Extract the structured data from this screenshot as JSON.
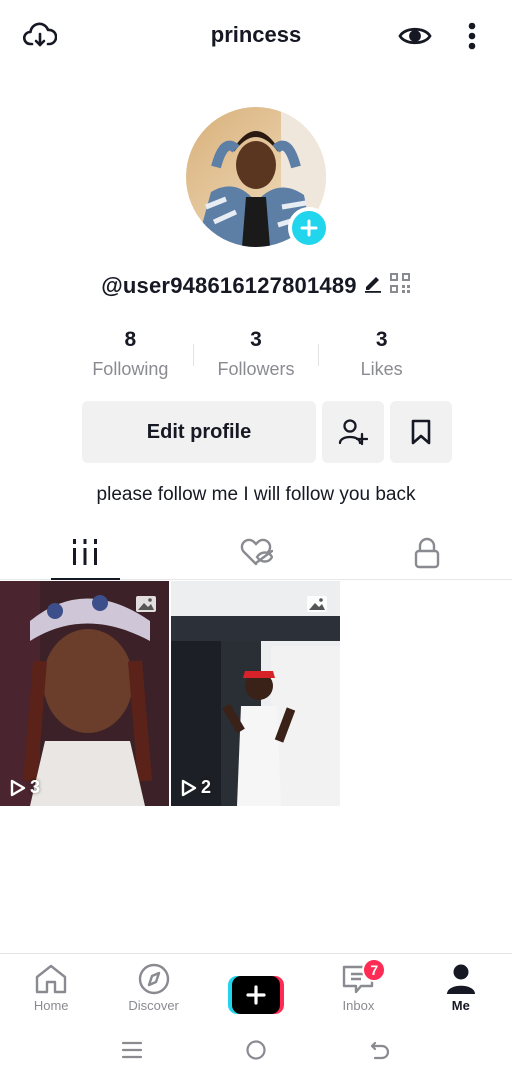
{
  "header": {
    "title": "princess",
    "icons": [
      "cloud-download-icon",
      "eye-icon",
      "more-vertical-icon"
    ]
  },
  "profile": {
    "username": "@user948616127801489",
    "bio": "please follow me I will follow you back"
  },
  "stats": [
    {
      "value": "8",
      "label": "Following"
    },
    {
      "value": "3",
      "label": "Followers"
    },
    {
      "value": "3",
      "label": "Likes"
    }
  ],
  "actions": {
    "edit_label": "Edit profile",
    "icons": [
      "add-friend-icon",
      "bookmark-icon"
    ]
  },
  "tabs": [
    {
      "icon": "videos-grid-icon",
      "active": true
    },
    {
      "icon": "liked-hidden-icon",
      "active": false
    },
    {
      "icon": "lock-icon",
      "active": false
    }
  ],
  "posts": [
    {
      "views": "3",
      "type": "photo"
    },
    {
      "views": "2",
      "type": "photo"
    }
  ],
  "bottom_nav": {
    "items": [
      {
        "label": "Home",
        "icon": "home-icon"
      },
      {
        "label": "Discover",
        "icon": "compass-icon"
      },
      {
        "label": "",
        "icon": "plus-icon"
      },
      {
        "label": "Inbox",
        "icon": "inbox-icon",
        "badge": "7"
      },
      {
        "label": "Me",
        "icon": "person-icon"
      }
    ]
  },
  "colors": {
    "accent_cyan": "#20d5ec",
    "accent_red": "#fe2c55",
    "text_primary": "#161823",
    "text_secondary": "#8a8b91",
    "button_bg": "#f1f1f2"
  }
}
